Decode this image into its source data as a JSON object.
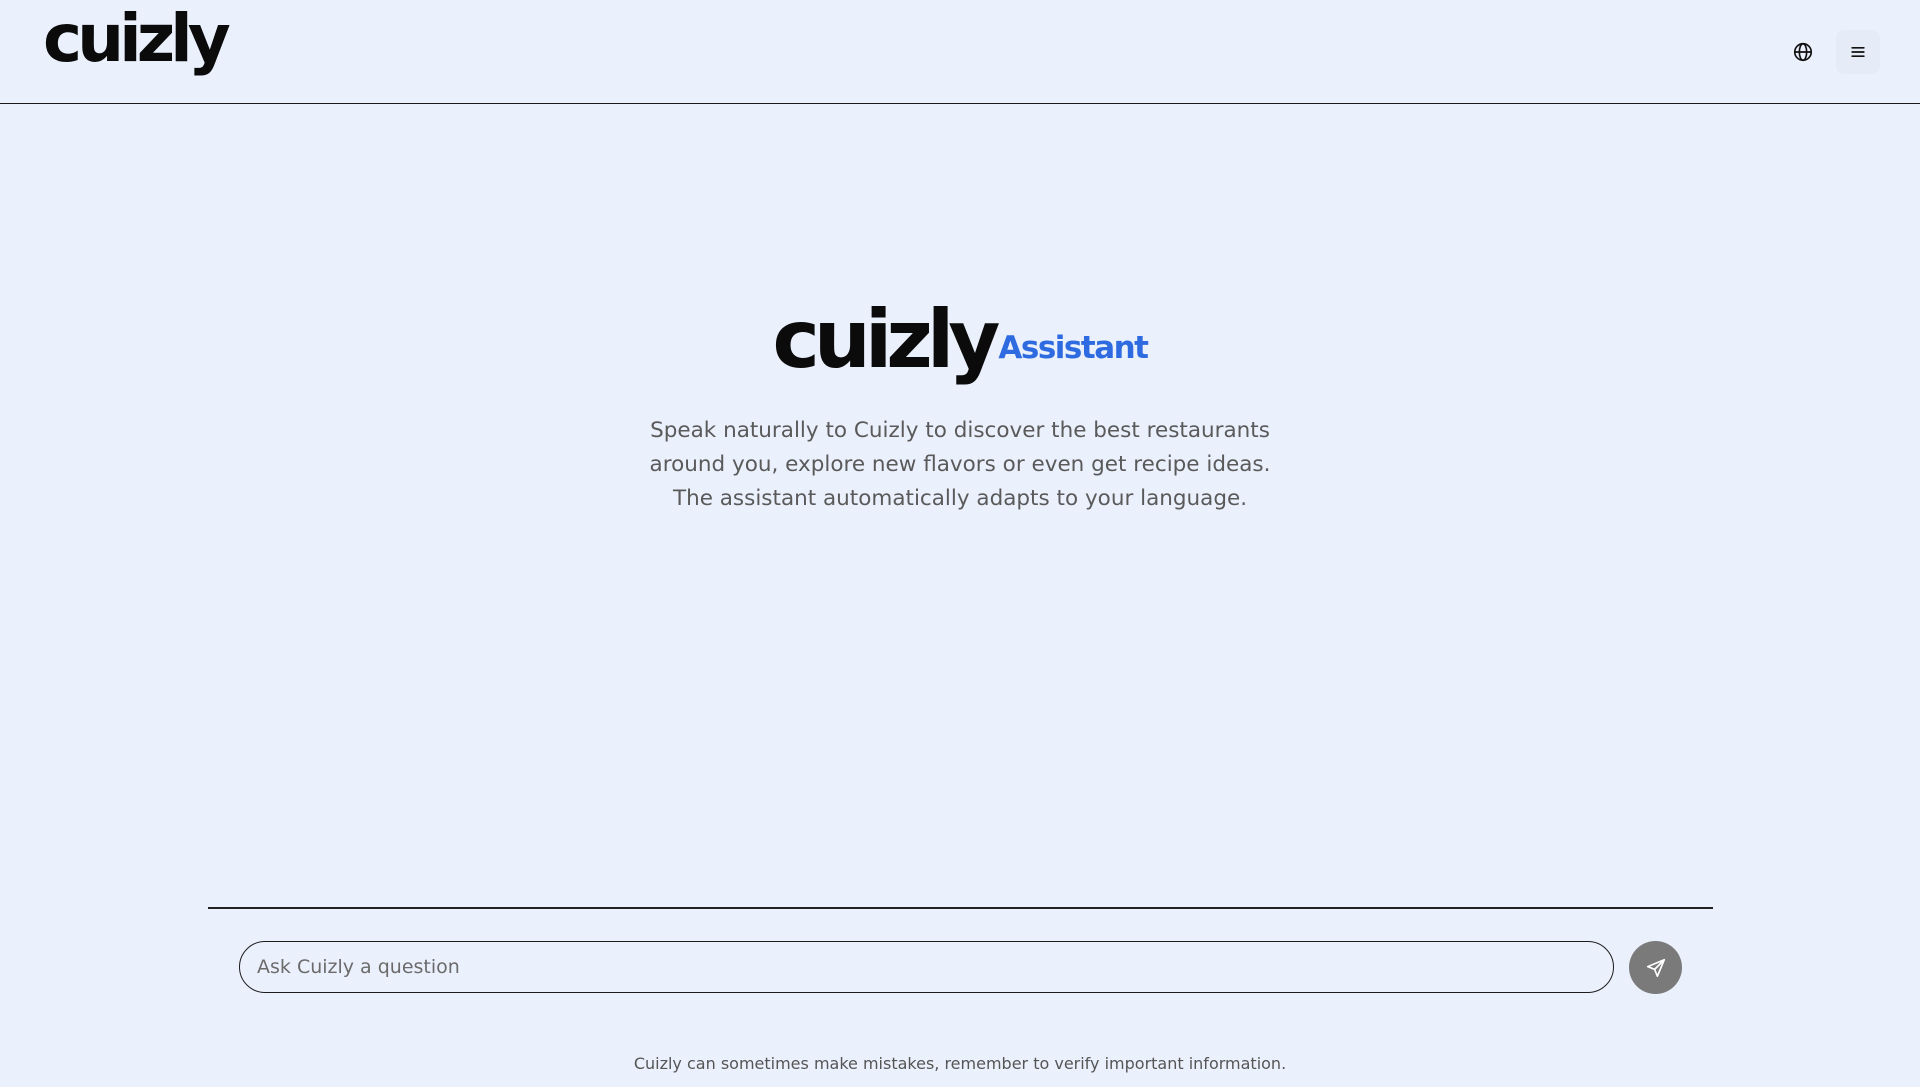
{
  "header": {
    "logo_text": "cuizly",
    "language_icon": "globe-icon",
    "menu_icon": "hamburger-menu-icon"
  },
  "hero": {
    "logo_text": "cuizly",
    "subtitle": "Assistant",
    "intro": "Speak naturally to Cuizly to discover the best restaurants around you, explore new flavors or even get recipe ideas. The assistant automatically adapts to your language."
  },
  "chat": {
    "placeholder": "Ask Cuizly a question",
    "value": "",
    "send_icon": "send-icon"
  },
  "footer": {
    "disclaimer": "Cuizly can sometimes make mistakes, remember to verify important information."
  },
  "colors": {
    "background": "#ebf0fd",
    "accent": "#2f6be0",
    "send_button": "#7a7a7a"
  }
}
